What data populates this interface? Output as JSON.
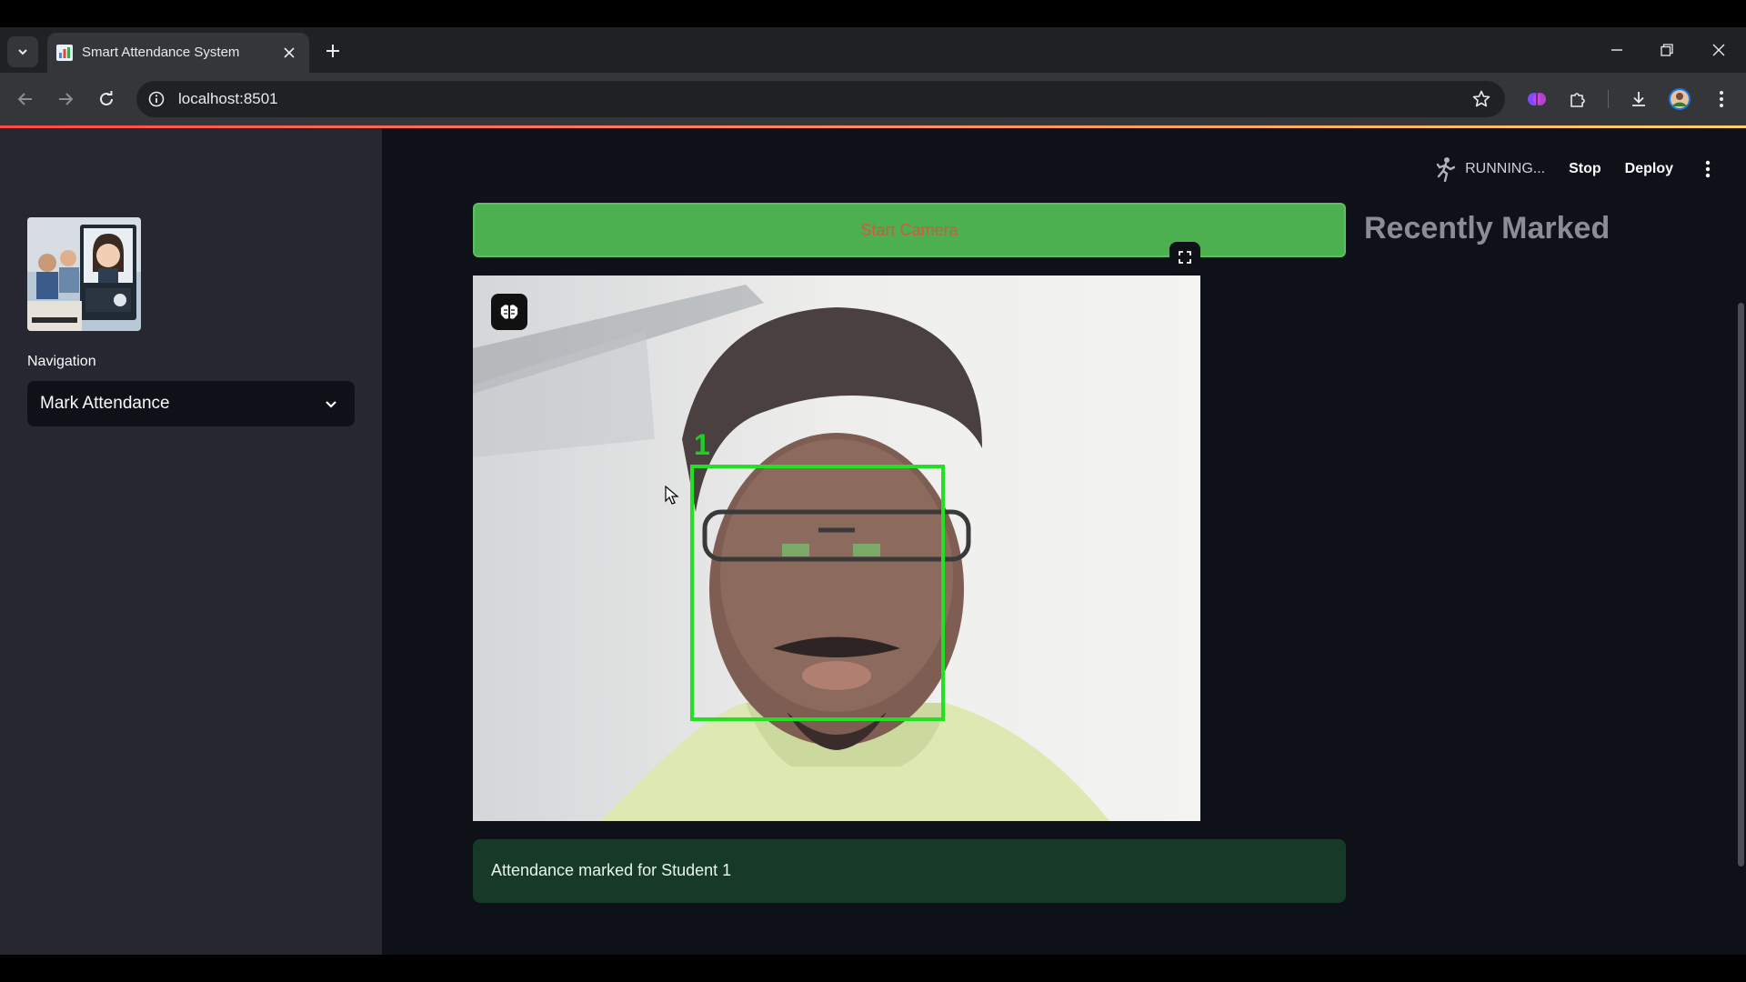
{
  "browser": {
    "tab_title": "Smart Attendance System",
    "url": "localhost:8501"
  },
  "sidebar": {
    "nav_label": "Navigation",
    "selected_page": "Mark Attendance"
  },
  "topbar": {
    "status": "RUNNING...",
    "stop_label": "Stop",
    "deploy_label": "Deploy"
  },
  "main": {
    "start_camera_label": "Start Camera",
    "recently_marked_title": "Recently Marked",
    "face_label": "1",
    "success_message": "Attendance marked for Student 1"
  },
  "colors": {
    "app_background": "#0e1117",
    "sidebar_background": "#262730",
    "start_button": "#4caf50",
    "start_button_text": "#d9573b",
    "face_box": "#22e022",
    "success_background": "#173928"
  },
  "icons": {
    "tab_menu": "chevron-down-icon",
    "favicon": "bar-chart-icon",
    "close": "close-icon",
    "new_tab": "plus-icon",
    "back": "arrow-left-icon",
    "forward": "arrow-right-icon",
    "reload": "reload-icon",
    "info": "info-icon",
    "bookmark": "star-icon",
    "extensions": "puzzle-icon",
    "download": "download-icon",
    "running": "running-man-icon",
    "menu": "kebab-icon",
    "fullscreen": "fullscreen-icon",
    "brain": "brain-icon"
  }
}
